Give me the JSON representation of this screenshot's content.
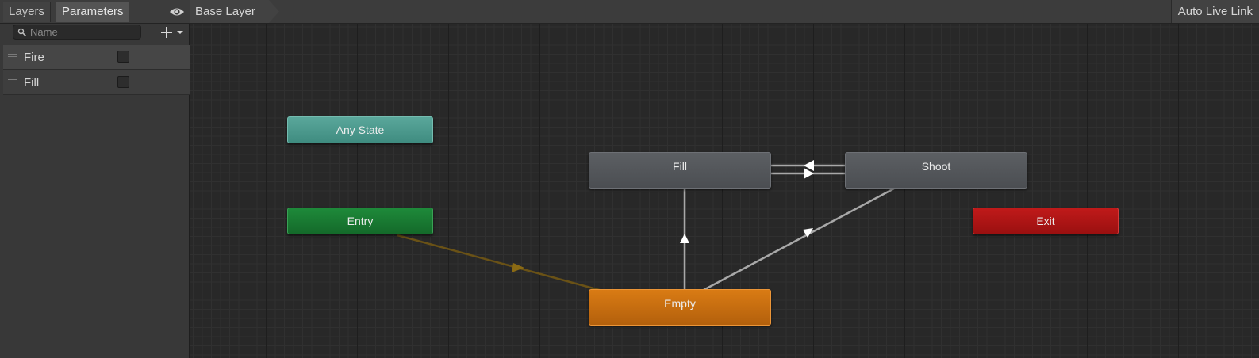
{
  "left_panel": {
    "tabs": [
      {
        "label": "Layers"
      },
      {
        "label": "Parameters"
      }
    ],
    "visibility_icon": "eye-icon",
    "search": {
      "placeholder": "Name",
      "value": "",
      "icon": "search-icon"
    },
    "add_button_icon": "plus-dropdown-icon",
    "parameters": [
      {
        "name": "Fire",
        "type": "trigger",
        "checked": false,
        "selected": true
      },
      {
        "name": "Fill",
        "type": "trigger",
        "checked": false,
        "selected": false
      }
    ]
  },
  "top_bar": {
    "breadcrumb": "Base Layer",
    "auto_live_link": "Auto Live Link"
  },
  "graph": {
    "states": {
      "any_state": "Any State",
      "entry": "Entry",
      "exit": "Exit",
      "fill": "Fill",
      "shoot": "Shoot",
      "empty": "Empty"
    },
    "default_state": "Empty",
    "transitions": [
      {
        "from": "Entry",
        "to": "Empty",
        "kind": "default"
      },
      {
        "from": "Empty",
        "to": "Fill"
      },
      {
        "from": "Empty",
        "to": "Shoot"
      },
      {
        "from": "Fill",
        "to": "Shoot"
      },
      {
        "from": "Shoot",
        "to": "Fill"
      }
    ],
    "colors": {
      "any_state": "#4a9a8e",
      "entry": "#1a7a33",
      "exit": "#ac1515",
      "default_state": "#c86d10",
      "state": "#54575b",
      "transition": "#a8a8a8",
      "entry_transition": "#6a5216"
    }
  }
}
